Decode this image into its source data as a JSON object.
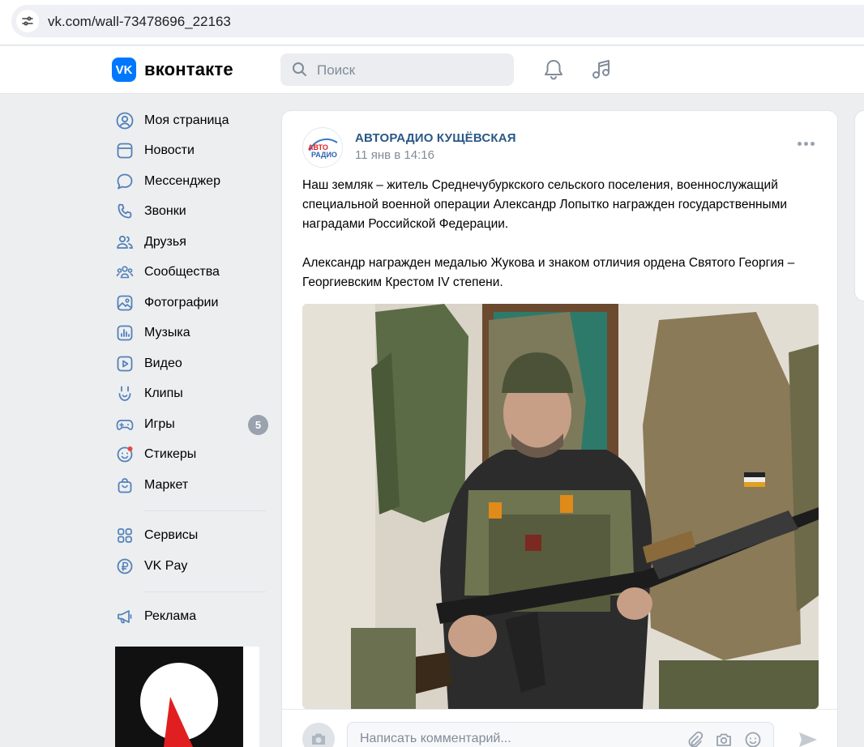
{
  "browser": {
    "url": "vk.com/wall-73478696_22163"
  },
  "header": {
    "logo_text": "вконтакте",
    "logo_letters": "VK",
    "search_placeholder": "Поиск"
  },
  "sidebar": {
    "items": [
      {
        "label": "Моя страница",
        "icon": "user-circle-icon"
      },
      {
        "label": "Новости",
        "icon": "news-icon"
      },
      {
        "label": "Мессенджер",
        "icon": "message-icon"
      },
      {
        "label": "Звонки",
        "icon": "phone-icon"
      },
      {
        "label": "Друзья",
        "icon": "friends-icon"
      },
      {
        "label": "Сообщества",
        "icon": "communities-icon"
      },
      {
        "label": "Фотографии",
        "icon": "photo-icon"
      },
      {
        "label": "Музыка",
        "icon": "music-icon"
      },
      {
        "label": "Видео",
        "icon": "video-icon"
      },
      {
        "label": "Клипы",
        "icon": "clips-icon"
      },
      {
        "label": "Игры",
        "icon": "gamepad-icon",
        "badge": "5"
      },
      {
        "label": "Стикеры",
        "icon": "sticker-icon"
      },
      {
        "label": "Маркет",
        "icon": "market-icon"
      }
    ],
    "items2": [
      {
        "label": "Сервисы",
        "icon": "services-icon"
      },
      {
        "label": "VK Pay",
        "icon": "vkpay-icon"
      }
    ],
    "items3": [
      {
        "label": "Реклама",
        "icon": "megaphone-icon"
      }
    ]
  },
  "post": {
    "author": "АВТОРАДИО КУЩЁВСКАЯ",
    "avatar_text_top": "АВТО",
    "avatar_text_bottom": "РАДИО",
    "date": "11 янв в 14:16",
    "paragraph1": "Наш земляк – житель Среднечубуркского сельского поселения, военнослужащий специальной военной операции Александр Лопытко награжден государственными наградами Российской Федерации.",
    "paragraph2": "Александр награжден медалью Жукова и знаком отличия ордена Святого Георгия – Георгиевским Крестом IV степени.",
    "comment_placeholder": "Написать комментарий..."
  },
  "colors": {
    "accent": "#0077ff",
    "link": "#2a5885",
    "secondary": "#818c99",
    "page_bg": "#edeef0"
  }
}
